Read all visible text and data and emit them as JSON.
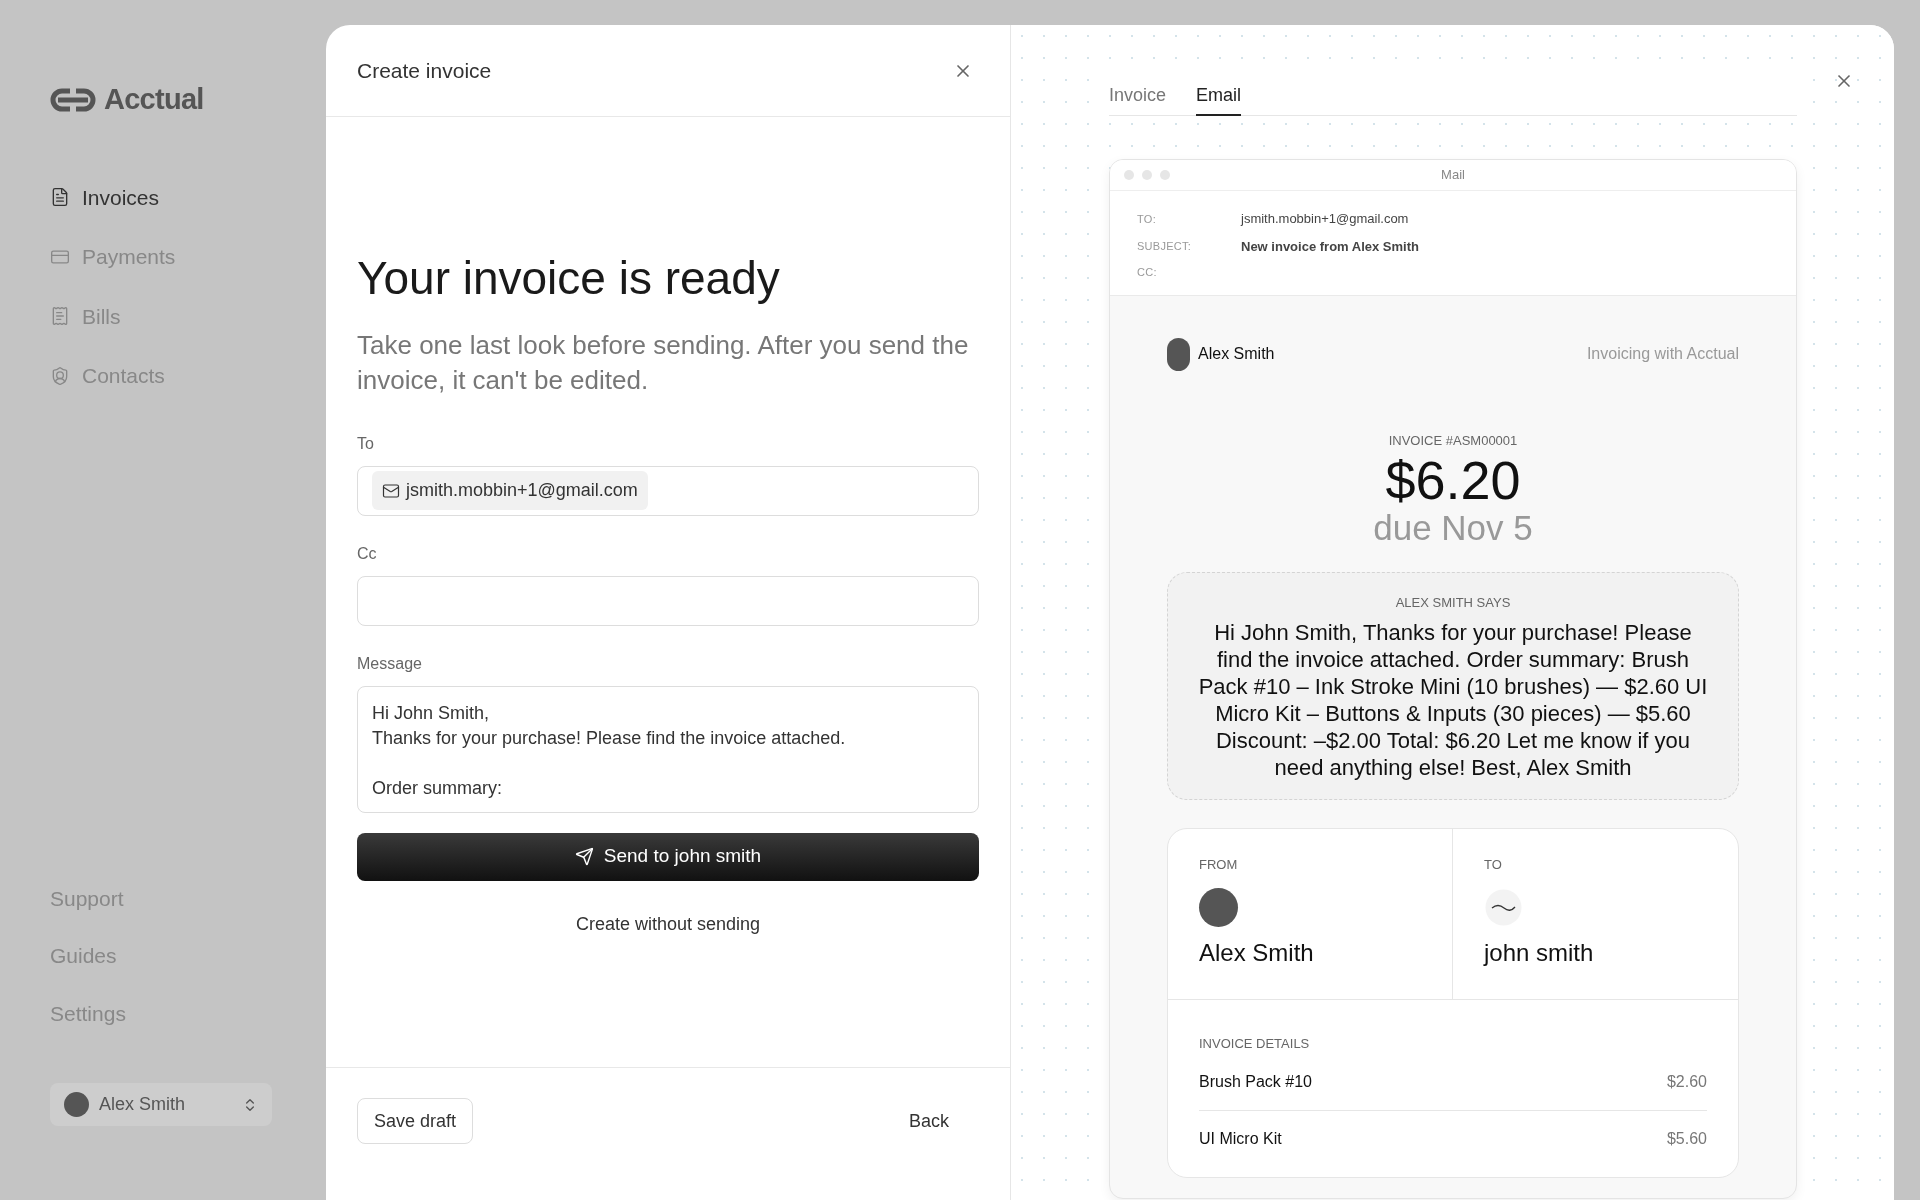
{
  "sidebar": {
    "logo": "Acctual",
    "nav": [
      {
        "label": "Invoices",
        "selected": true
      },
      {
        "label": "Payments",
        "selected": false
      },
      {
        "label": "Bills",
        "selected": false
      },
      {
        "label": "Contacts",
        "selected": false
      }
    ],
    "footer_links": [
      "Support",
      "Guides",
      "Settings"
    ],
    "account": {
      "name": "Alex Smith"
    }
  },
  "form": {
    "title": "Create invoice",
    "heading": "Your invoice is ready",
    "description": "Take one last look before sending. After you send the invoice, it can't be edited.",
    "to": {
      "label": "To",
      "chips": [
        "jsmith.mobbin+1@gmail.com"
      ]
    },
    "cc": {
      "label": "Cc"
    },
    "message": {
      "label": "Message",
      "value": "Hi John Smith,\nThanks for your purchase! Please find the invoice attached.\n\nOrder summary:"
    },
    "send_button": "Send to john smith",
    "secondary_button": "Create without sending",
    "save_draft": "Save draft",
    "back": "Back"
  },
  "preview": {
    "tabs": [
      {
        "label": "Invoice",
        "selected": false
      },
      {
        "label": "Email",
        "selected": true
      }
    ],
    "mail": {
      "window_title": "Mail",
      "to": {
        "label": "TO:",
        "value": "jsmith.mobbin+1@gmail.com"
      },
      "subject": {
        "label": "SUBJECT:",
        "value": "New invoice from Alex Smith"
      },
      "cc": {
        "label": "CC:"
      },
      "sender": "Alex Smith",
      "branding": "Invoicing with Acctual",
      "invoice_number": "INVOICE #ASM00001",
      "amount": "$6.20",
      "due": "due Nov 5",
      "message_label": "ALEX SMITH SAYS",
      "message": "Hi John Smith, Thanks for your purchase! Please find the invoice attached. Order summary: Brush Pack #10 – Ink Stroke Mini (10 brushes) — $2.60 UI Micro Kit – Buttons & Inputs (30 pieces) — $5.60 Discount: –$2.00 Total: $6.20 Let me know if you need anything else! Best, Alex Smith",
      "from": {
        "label": "FROM",
        "name": "Alex Smith"
      },
      "recipient": {
        "label": "TO",
        "name": "john smith"
      },
      "details_label": "INVOICE DETAILS",
      "items": [
        {
          "name": "Brush Pack #10",
          "amount": "$2.60"
        },
        {
          "name": "UI Micro Kit",
          "amount": "$5.60"
        }
      ]
    }
  }
}
